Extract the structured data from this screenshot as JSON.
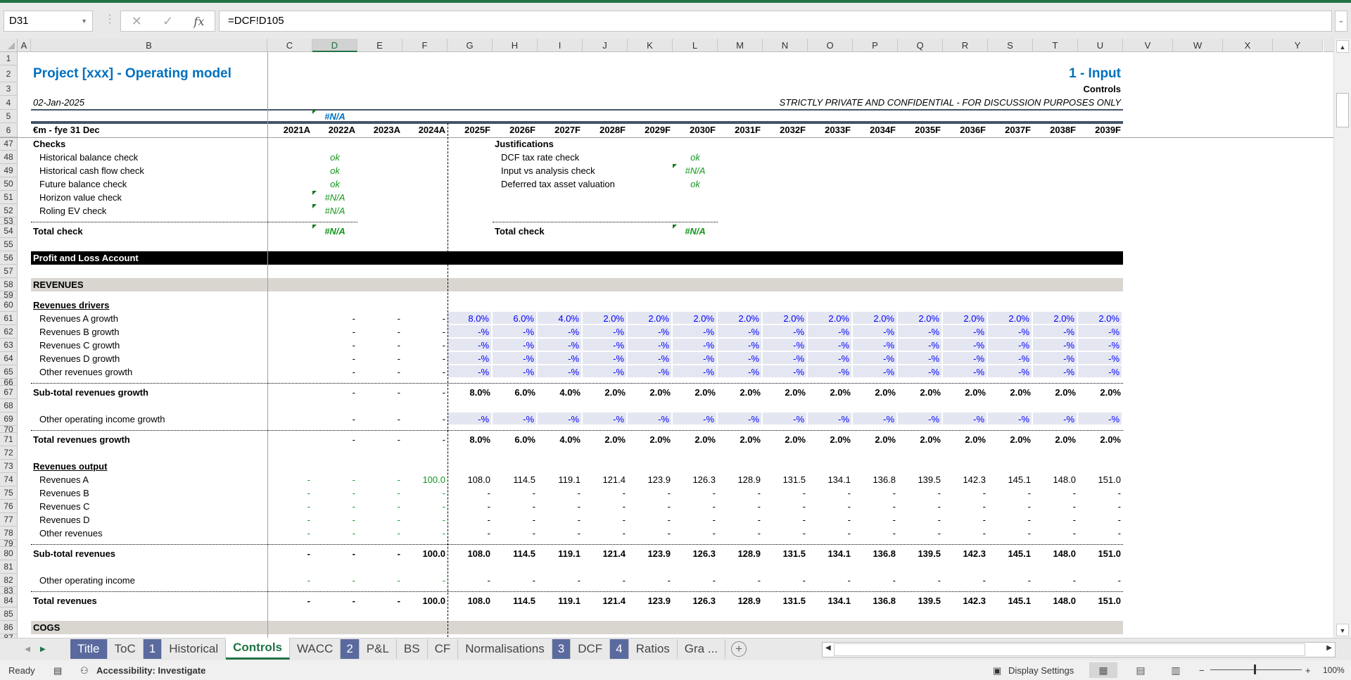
{
  "formula_bar": {
    "name_box": "D31",
    "cancel_icon": "✕",
    "enter_icon": "✓",
    "fx_label": "fx",
    "formula": "=DCF!D105"
  },
  "columns": [
    "A",
    "B",
    "C",
    "D",
    "E",
    "F",
    "G",
    "H",
    "I",
    "J",
    "K",
    "L",
    "M",
    "N",
    "O",
    "P",
    "Q",
    "R",
    "S",
    "T",
    "U",
    "V",
    "W",
    "X",
    "Y"
  ],
  "selected_column": "D",
  "colors": {
    "accent": "#217346",
    "title_blue": "#0070c0",
    "input_fill": "#e4e6f1",
    "input_text": "#0000ff",
    "check_green": "#14961e",
    "section_grey": "#d9d6d0",
    "tab_number": "#5a6a9e"
  },
  "rows": [
    {
      "n": "1"
    },
    {
      "n": "2",
      "cells": [
        {
          "col": "B",
          "text": "Project [xxx] - Operating model",
          "style": "title lbl"
        },
        {
          "col": "U",
          "text": "1 - Input",
          "style": "title r wide"
        }
      ]
    },
    {
      "n": "3",
      "cells": [
        {
          "col": "U",
          "text": "Controls",
          "style": "b r wide"
        }
      ]
    },
    {
      "n": "4",
      "line": "under",
      "cells": [
        {
          "col": "B",
          "text": "02-Jan-2025",
          "style": "ital lbl"
        },
        {
          "col": "U",
          "text": "STRICTLY PRIVATE AND CONFIDENTIAL - FOR DISCUSSION PURPOSES ONLY",
          "style": "ital r wide"
        }
      ]
    },
    {
      "n": "5",
      "line": "thick",
      "cells": [
        {
          "col": "D",
          "text": "#N/A",
          "style": "blueerr ctr tri"
        }
      ]
    },
    {
      "n": "6",
      "cells": [
        {
          "col": "B",
          "text": "€m - fye 31 Dec",
          "style": "b lbl"
        },
        {
          "from": "C",
          "style": "b r",
          "values": [
            "2021A",
            "2022A",
            "2023A",
            "2024A",
            "2025F",
            "2026F",
            "2027F",
            "2028F",
            "2029F",
            "2030F",
            "2031F",
            "2032F",
            "2033F",
            "2034F",
            "2035F",
            "2036F",
            "2037F",
            "2038F",
            "2039F"
          ]
        }
      ]
    },
    {
      "n": "47",
      "cells": [
        {
          "col": "B",
          "text": "Checks",
          "style": "b lbl"
        },
        {
          "col": "H",
          "text": "Justifications",
          "style": "b lbl"
        }
      ]
    },
    {
      "n": "48",
      "cells": [
        {
          "col": "B",
          "text": "Historical balance check",
          "style": "lbl ind"
        },
        {
          "col": "D",
          "text": "ok",
          "style": "ok ctr"
        },
        {
          "col": "H",
          "text": "DCF tax rate check",
          "style": "lbl ind"
        },
        {
          "col": "L",
          "text": "ok",
          "style": "ok ctr"
        }
      ]
    },
    {
      "n": "49",
      "cells": [
        {
          "col": "B",
          "text": "Historical cash flow check",
          "style": "lbl ind"
        },
        {
          "col": "D",
          "text": "ok",
          "style": "ok ctr"
        },
        {
          "col": "H",
          "text": "Input vs analysis check",
          "style": "lbl ind"
        },
        {
          "col": "L",
          "text": "#N/A",
          "style": "err ctr tri"
        }
      ]
    },
    {
      "n": "50",
      "cells": [
        {
          "col": "B",
          "text": "Future balance check",
          "style": "lbl ind"
        },
        {
          "col": "D",
          "text": "ok",
          "style": "ok ctr"
        },
        {
          "col": "H",
          "text": "Deferred tax asset valuation",
          "style": "lbl ind"
        },
        {
          "col": "L",
          "text": "ok",
          "style": "ok ctr"
        }
      ]
    },
    {
      "n": "51",
      "cells": [
        {
          "col": "B",
          "text": "Horizon value check",
          "style": "lbl ind"
        },
        {
          "col": "D",
          "text": "#N/A",
          "style": "err ctr tri"
        }
      ]
    },
    {
      "n": "52",
      "cells": [
        {
          "col": "B",
          "text": "Roling EV check",
          "style": "lbl ind"
        },
        {
          "col": "D",
          "text": "#N/A",
          "style": "err ctr tri"
        }
      ]
    },
    {
      "n": "53",
      "tiny": true
    },
    {
      "n": "54",
      "line": "checks",
      "cells": [
        {
          "col": "B",
          "text": "Total check",
          "style": "b lbl"
        },
        {
          "col": "D",
          "text": "#N/A",
          "style": "errb ctr tri"
        },
        {
          "col": "H",
          "text": "Total check",
          "style": "b lbl"
        },
        {
          "col": "L",
          "text": "#N/A",
          "style": "errb ctr tri"
        }
      ]
    },
    {
      "n": "55"
    },
    {
      "n": "56",
      "band": "black",
      "cells": [
        {
          "col": "B",
          "text": "Profit and Loss Account",
          "style": "wht lbl"
        }
      ]
    },
    {
      "n": "57"
    },
    {
      "n": "58",
      "band": "grey",
      "cells": [
        {
          "col": "B",
          "text": "REVENUES",
          "style": "b lbl"
        }
      ]
    },
    {
      "n": "59",
      "tiny": true
    },
    {
      "n": "60",
      "cells": [
        {
          "col": "B",
          "text": "Revenues drivers",
          "style": "b u lbl"
        }
      ]
    },
    {
      "n": "61",
      "cells": [
        {
          "col": "B",
          "text": "Revenues A growth",
          "style": "lbl ind"
        },
        {
          "from": "D",
          "style": "r",
          "values": [
            "-",
            "-",
            "-"
          ]
        },
        {
          "from": "G",
          "style": "r inp",
          "values": [
            "8.0%",
            "6.0%",
            "4.0%",
            "2.0%",
            "2.0%",
            "2.0%",
            "2.0%",
            "2.0%",
            "2.0%",
            "2.0%",
            "2.0%",
            "2.0%",
            "2.0%",
            "2.0%",
            "2.0%"
          ]
        }
      ]
    },
    {
      "n": "62",
      "cells": [
        {
          "col": "B",
          "text": "Revenues B growth",
          "style": "lbl ind"
        },
        {
          "from": "D",
          "style": "r",
          "values": [
            "-",
            "-",
            "-"
          ]
        },
        {
          "from": "G",
          "style": "r inp",
          "values": [
            "-%",
            "-%",
            "-%",
            "-%",
            "-%",
            "-%",
            "-%",
            "-%",
            "-%",
            "-%",
            "-%",
            "-%",
            "-%",
            "-%",
            "-%"
          ]
        }
      ]
    },
    {
      "n": "63",
      "cells": [
        {
          "col": "B",
          "text": "Revenues C growth",
          "style": "lbl ind"
        },
        {
          "from": "D",
          "style": "r",
          "values": [
            "-",
            "-",
            "-"
          ]
        },
        {
          "from": "G",
          "style": "r inp",
          "values": [
            "-%",
            "-%",
            "-%",
            "-%",
            "-%",
            "-%",
            "-%",
            "-%",
            "-%",
            "-%",
            "-%",
            "-%",
            "-%",
            "-%",
            "-%"
          ]
        }
      ]
    },
    {
      "n": "64",
      "cells": [
        {
          "col": "B",
          "text": "Revenues D growth",
          "style": "lbl ind"
        },
        {
          "from": "D",
          "style": "r",
          "values": [
            "-",
            "-",
            "-"
          ]
        },
        {
          "from": "G",
          "style": "r inp",
          "values": [
            "-%",
            "-%",
            "-%",
            "-%",
            "-%",
            "-%",
            "-%",
            "-%",
            "-%",
            "-%",
            "-%",
            "-%",
            "-%",
            "-%",
            "-%"
          ]
        }
      ]
    },
    {
      "n": "65",
      "cells": [
        {
          "col": "B",
          "text": "Other revenues growth",
          "style": "lbl ind"
        },
        {
          "from": "D",
          "style": "r",
          "values": [
            "-",
            "-",
            "-"
          ]
        },
        {
          "from": "G",
          "style": "r inp",
          "values": [
            "-%",
            "-%",
            "-%",
            "-%",
            "-%",
            "-%",
            "-%",
            "-%",
            "-%",
            "-%",
            "-%",
            "-%",
            "-%",
            "-%",
            "-%"
          ]
        }
      ]
    },
    {
      "n": "66",
      "tiny": true
    },
    {
      "n": "67",
      "line": "total",
      "cells": [
        {
          "col": "B",
          "text": "Sub-total revenues growth",
          "style": "b lbl"
        },
        {
          "from": "D",
          "style": "r",
          "values": [
            "-",
            "-",
            "-"
          ]
        },
        {
          "from": "G",
          "style": "r b",
          "values": [
            "8.0%",
            "6.0%",
            "4.0%",
            "2.0%",
            "2.0%",
            "2.0%",
            "2.0%",
            "2.0%",
            "2.0%",
            "2.0%",
            "2.0%",
            "2.0%",
            "2.0%",
            "2.0%",
            "2.0%"
          ]
        }
      ]
    },
    {
      "n": "68"
    },
    {
      "n": "69",
      "cells": [
        {
          "col": "B",
          "text": "Other operating income growth",
          "style": "lbl ind"
        },
        {
          "from": "D",
          "style": "r",
          "values": [
            "-",
            "-",
            "-"
          ]
        },
        {
          "from": "G",
          "style": "r inp",
          "values": [
            "-%",
            "-%",
            "-%",
            "-%",
            "-%",
            "-%",
            "-%",
            "-%",
            "-%",
            "-%",
            "-%",
            "-%",
            "-%",
            "-%",
            "-%"
          ]
        }
      ]
    },
    {
      "n": "70",
      "tiny": true
    },
    {
      "n": "71",
      "line": "total",
      "cells": [
        {
          "col": "B",
          "text": "Total revenues growth",
          "style": "b lbl"
        },
        {
          "from": "D",
          "style": "r",
          "values": [
            "-",
            "-",
            "-"
          ]
        },
        {
          "from": "G",
          "style": "r b",
          "values": [
            "8.0%",
            "6.0%",
            "4.0%",
            "2.0%",
            "2.0%",
            "2.0%",
            "2.0%",
            "2.0%",
            "2.0%",
            "2.0%",
            "2.0%",
            "2.0%",
            "2.0%",
            "2.0%",
            "2.0%"
          ]
        }
      ]
    },
    {
      "n": "72"
    },
    {
      "n": "73",
      "cells": [
        {
          "col": "B",
          "text": "Revenues output",
          "style": "b u lbl"
        }
      ]
    },
    {
      "n": "74",
      "cells": [
        {
          "col": "B",
          "text": "Revenues A",
          "style": "lbl ind"
        },
        {
          "from": "C",
          "style": "r grn",
          "values": [
            "-",
            "-",
            "-",
            "100.0"
          ]
        },
        {
          "from": "G",
          "style": "r",
          "values": [
            "108.0",
            "114.5",
            "119.1",
            "121.4",
            "123.9",
            "126.3",
            "128.9",
            "131.5",
            "134.1",
            "136.8",
            "139.5",
            "142.3",
            "145.1",
            "148.0",
            "151.0"
          ]
        }
      ]
    },
    {
      "n": "75",
      "cells": [
        {
          "col": "B",
          "text": "Revenues B",
          "style": "lbl ind"
        },
        {
          "from": "C",
          "style": "r grn",
          "values": [
            "-",
            "-",
            "-",
            "-"
          ]
        },
        {
          "from": "G",
          "style": "r",
          "values": [
            "-",
            "-",
            "-",
            "-",
            "-",
            "-",
            "-",
            "-",
            "-",
            "-",
            "-",
            "-",
            "-",
            "-",
            "-"
          ]
        }
      ]
    },
    {
      "n": "76",
      "cells": [
        {
          "col": "B",
          "text": "Revenues C",
          "style": "lbl ind"
        },
        {
          "from": "C",
          "style": "r grn",
          "values": [
            "-",
            "-",
            "-",
            "-"
          ]
        },
        {
          "from": "G",
          "style": "r",
          "values": [
            "-",
            "-",
            "-",
            "-",
            "-",
            "-",
            "-",
            "-",
            "-",
            "-",
            "-",
            "-",
            "-",
            "-",
            "-"
          ]
        }
      ]
    },
    {
      "n": "77",
      "cells": [
        {
          "col": "B",
          "text": "Revenues D",
          "style": "lbl ind"
        },
        {
          "from": "C",
          "style": "r grn",
          "values": [
            "-",
            "-",
            "-",
            "-"
          ]
        },
        {
          "from": "G",
          "style": "r",
          "values": [
            "-",
            "-",
            "-",
            "-",
            "-",
            "-",
            "-",
            "-",
            "-",
            "-",
            "-",
            "-",
            "-",
            "-",
            "-"
          ]
        }
      ]
    },
    {
      "n": "78",
      "cells": [
        {
          "col": "B",
          "text": "Other revenues",
          "style": "lbl ind"
        },
        {
          "from": "C",
          "style": "r grn",
          "values": [
            "-",
            "-",
            "-",
            "-"
          ]
        },
        {
          "from": "G",
          "style": "r",
          "values": [
            "-",
            "-",
            "-",
            "-",
            "-",
            "-",
            "-",
            "-",
            "-",
            "-",
            "-",
            "-",
            "-",
            "-",
            "-"
          ]
        }
      ]
    },
    {
      "n": "79",
      "tiny": true
    },
    {
      "n": "80",
      "line": "total",
      "cells": [
        {
          "col": "B",
          "text": "Sub-total revenues",
          "style": "b lbl"
        },
        {
          "from": "C",
          "style": "r b",
          "values": [
            "-",
            "-",
            "-",
            "100.0",
            "108.0",
            "114.5",
            "119.1",
            "121.4",
            "123.9",
            "126.3",
            "128.9",
            "131.5",
            "134.1",
            "136.8",
            "139.5",
            "142.3",
            "145.1",
            "148.0",
            "151.0"
          ]
        }
      ]
    },
    {
      "n": "81"
    },
    {
      "n": "82",
      "cells": [
        {
          "col": "B",
          "text": "Other operating income",
          "style": "lbl ind"
        },
        {
          "from": "C",
          "style": "r grn",
          "values": [
            "-",
            "-",
            "-",
            "-"
          ]
        },
        {
          "from": "G",
          "style": "r",
          "values": [
            "-",
            "-",
            "-",
            "-",
            "-",
            "-",
            "-",
            "-",
            "-",
            "-",
            "-",
            "-",
            "-",
            "-",
            "-"
          ]
        }
      ]
    },
    {
      "n": "83",
      "tiny": true
    },
    {
      "n": "84",
      "line": "total",
      "cells": [
        {
          "col": "B",
          "text": "Total revenues",
          "style": "b lbl"
        },
        {
          "from": "C",
          "style": "r b",
          "values": [
            "-",
            "-",
            "-",
            "100.0",
            "108.0",
            "114.5",
            "119.1",
            "121.4",
            "123.9",
            "126.3",
            "128.9",
            "131.5",
            "134.1",
            "136.8",
            "139.5",
            "142.3",
            "145.1",
            "148.0",
            "151.0"
          ]
        }
      ]
    },
    {
      "n": "85"
    },
    {
      "n": "86",
      "band": "grey",
      "cells": [
        {
          "col": "B",
          "text": "COGS",
          "style": "b lbl"
        }
      ]
    },
    {
      "n": "87",
      "tiny": true
    }
  ],
  "sheet_tabs": [
    {
      "label": "Title",
      "kind": "color"
    },
    {
      "label": "ToC",
      "kind": "plain"
    },
    {
      "label": "1",
      "kind": "num"
    },
    {
      "label": "Historical",
      "kind": "plain"
    },
    {
      "label": "Controls",
      "kind": "active"
    },
    {
      "label": "WACC",
      "kind": "plain"
    },
    {
      "label": "2",
      "kind": "num"
    },
    {
      "label": "P&L",
      "kind": "plain"
    },
    {
      "label": "BS",
      "kind": "plain"
    },
    {
      "label": "CF",
      "kind": "plain"
    },
    {
      "label": "Normalisations",
      "kind": "plain"
    },
    {
      "label": "3",
      "kind": "num"
    },
    {
      "label": "DCF",
      "kind": "plain"
    },
    {
      "label": "4",
      "kind": "num"
    },
    {
      "label": "Ratios",
      "kind": "plain"
    },
    {
      "label": "Gra ...",
      "kind": "plain"
    }
  ],
  "status_bar": {
    "ready": "Ready",
    "accessibility": "Accessibility: Investigate",
    "display_settings": "Display Settings",
    "zoom": "100%",
    "zoom_level_percent": 100
  }
}
